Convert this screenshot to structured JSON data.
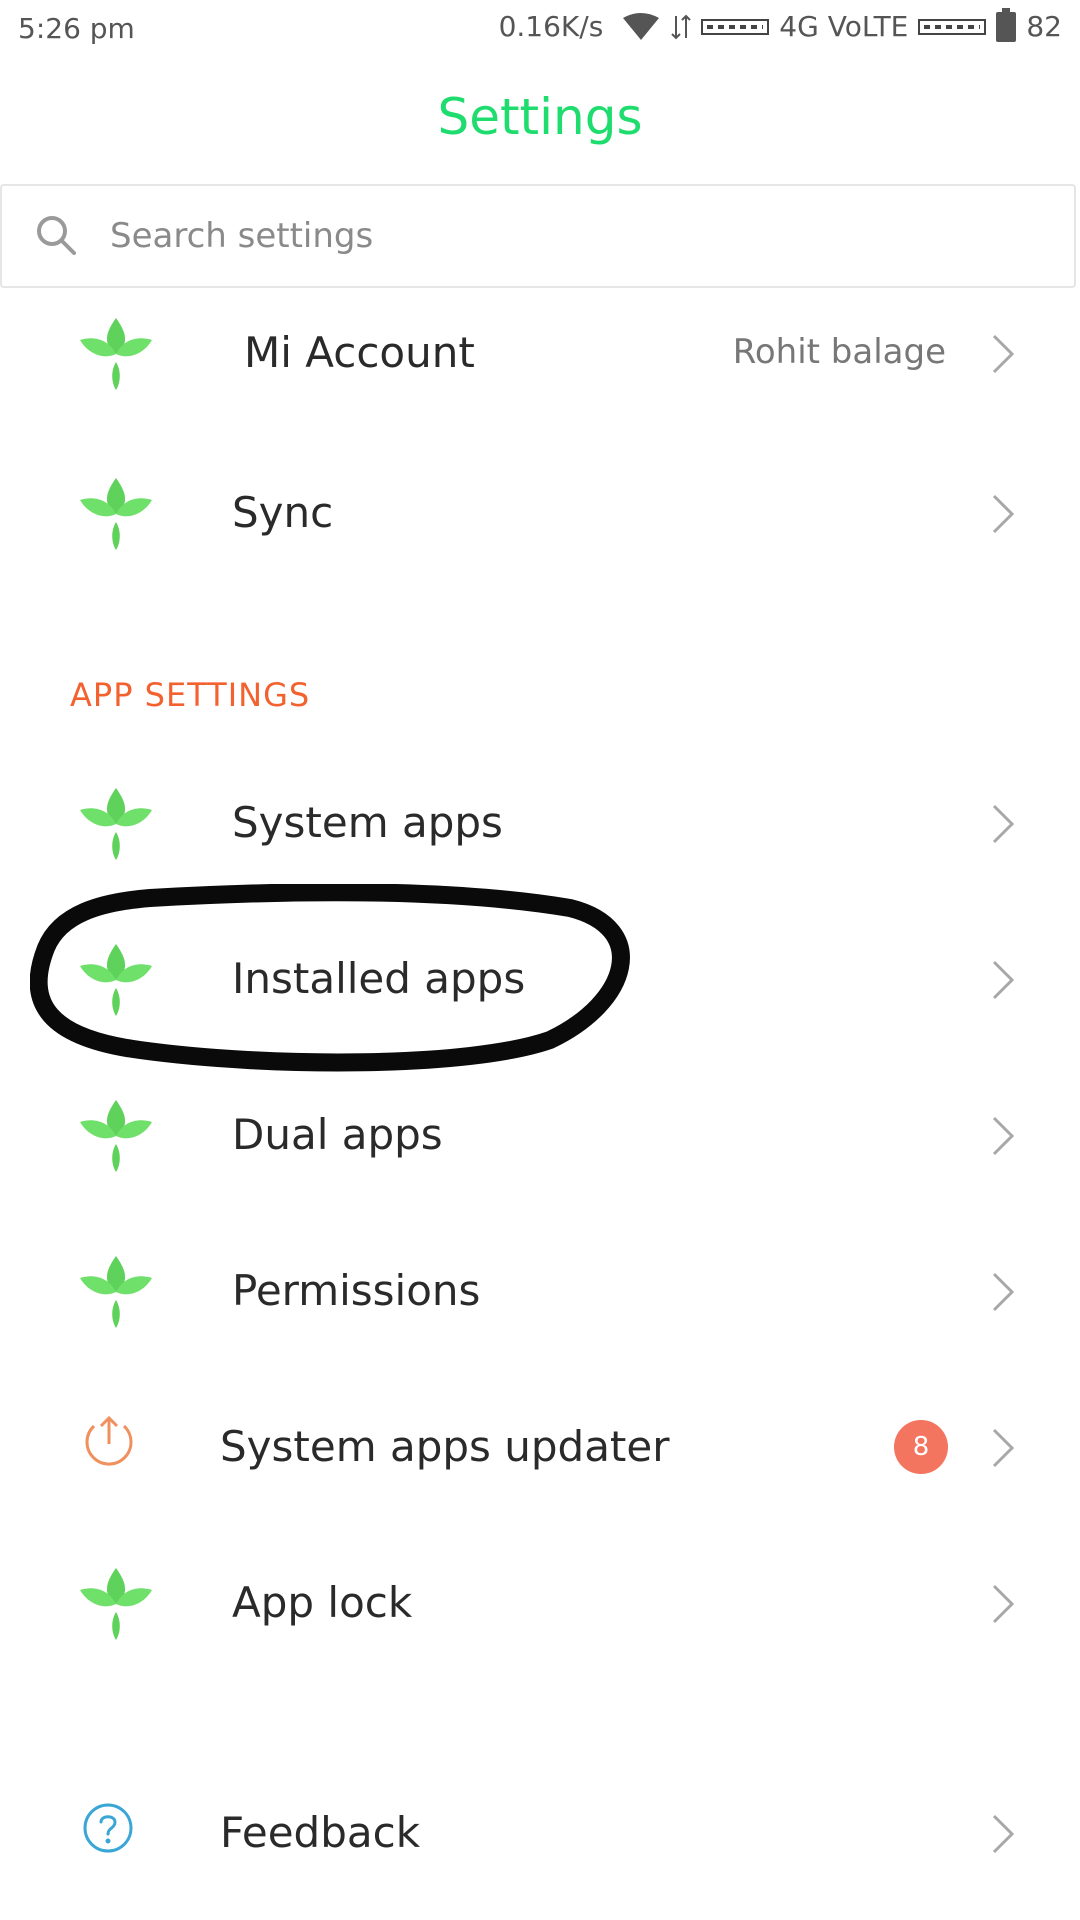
{
  "status_bar": {
    "time": "5:26 pm",
    "net_speed": "0.16K/s",
    "network": "4G VoLTE",
    "battery": "82"
  },
  "title": "Settings",
  "search": {
    "placeholder": "Search settings"
  },
  "account_rows": [
    {
      "label": "Mi Account",
      "value": "Rohit balage",
      "icon": "leaf-icon"
    },
    {
      "label": "Sync",
      "value": "",
      "icon": "leaf-icon"
    }
  ],
  "app_settings": {
    "header": "APP SETTINGS",
    "items": [
      {
        "label": "System apps",
        "icon": "leaf-icon"
      },
      {
        "label": "Installed apps",
        "icon": "leaf-icon",
        "annotated": true
      },
      {
        "label": "Dual apps",
        "icon": "leaf-icon"
      },
      {
        "label": "Permissions",
        "icon": "leaf-icon"
      },
      {
        "label": "System apps updater",
        "icon": "upload-icon",
        "badge": "8"
      },
      {
        "label": "App lock",
        "icon": "leaf-icon"
      }
    ]
  },
  "feedback": {
    "label": "Feedback",
    "icon": "question-icon"
  },
  "colors": {
    "title": "#1fdc6e",
    "section_header": "#f3612f",
    "badge": "#f3745f",
    "leaf": "#5fd25c"
  }
}
